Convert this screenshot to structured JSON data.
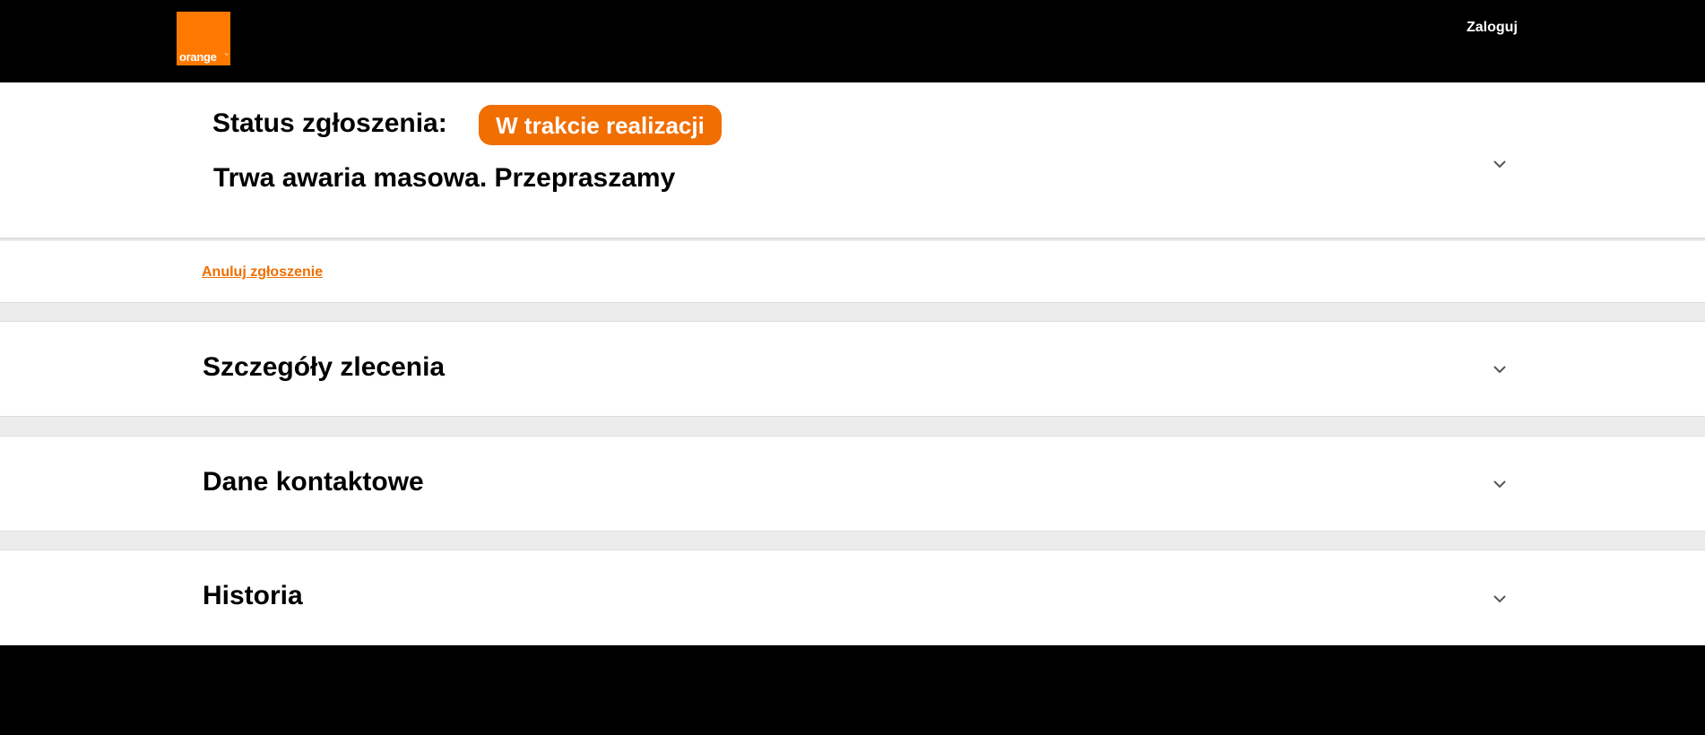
{
  "header": {
    "logo_text": "orange",
    "logo_tm": "™",
    "login_label": "Zaloguj"
  },
  "status": {
    "label": "Status zgłoszenia:",
    "badge": "W trakcie realizacji",
    "message": "Trwa awaria masowa. Przepraszamy"
  },
  "cancel": {
    "label": "Anuluj zgłoszenie"
  },
  "sections": [
    {
      "title": "Szczegóły zlecenia"
    },
    {
      "title": "Dane kontaktowe"
    },
    {
      "title": "Historia"
    }
  ],
  "colors": {
    "brand": "#ff7900",
    "badge": "#f16e00",
    "background": "#000000",
    "panel": "#ffffff",
    "separator": "#ececec"
  },
  "icons": {
    "expand": "chevron-down-icon"
  }
}
